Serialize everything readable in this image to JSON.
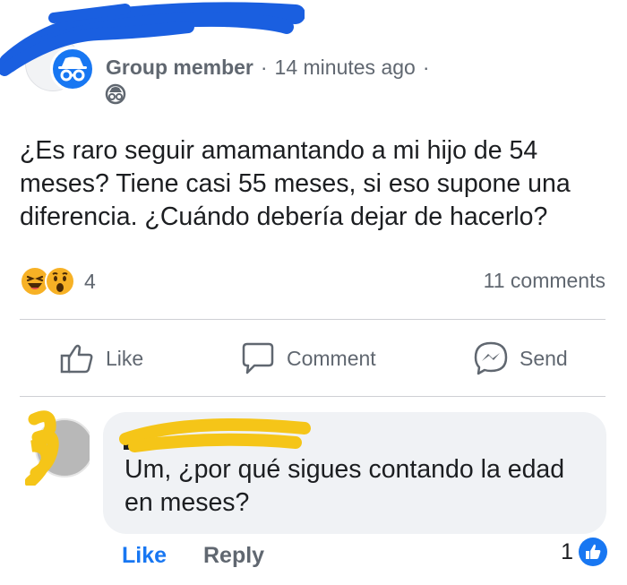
{
  "post": {
    "author": "Group member",
    "separator": "·",
    "time": "14 minutes ago",
    "time_suffix": "·",
    "privacy_icon": "anonymous-icon",
    "body": "¿Es raro seguir amamantando a mi hijo de 54 meses? Tiene casi 55 meses, si eso supone una diferencia. ¿Cuándo debería dejar de hacerlo?",
    "reactions": {
      "icons": [
        "laughing-emoji-icon",
        "wow-emoji-icon"
      ],
      "count": "4"
    },
    "comments_count": "11 comments"
  },
  "actions": {
    "like": "Like",
    "comment": "Comment",
    "send": "Send"
  },
  "comment": {
    "text": "Um, ¿por qué sigues contando la edad en meses?",
    "like": "Like",
    "reply": "Reply",
    "likes_count": "1"
  },
  "colors": {
    "facebook_blue": "#1877f2",
    "meta_gray": "#606770",
    "redaction_blue": "#1a5fe0",
    "redaction_yellow": "#f5c518"
  }
}
